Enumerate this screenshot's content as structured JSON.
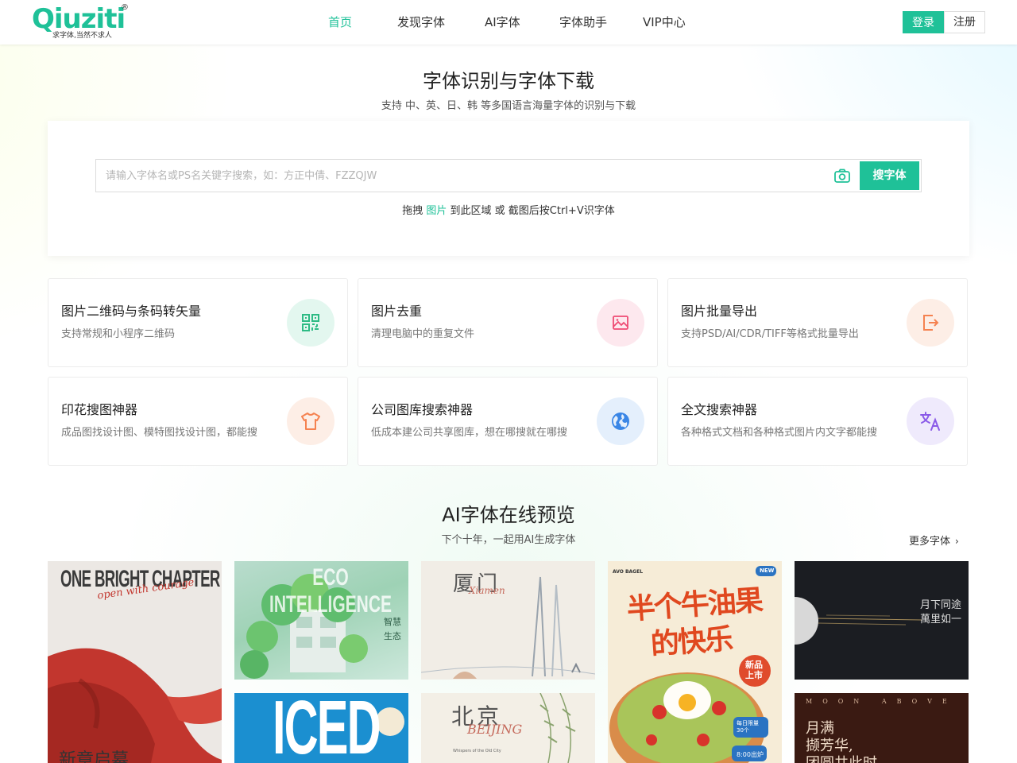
{
  "header": {
    "logo_word": "Qiuziti",
    "logo_reg": "®",
    "logo_slogan": "求字体,当然不求人",
    "nav": [
      {
        "label": "首页",
        "active": true
      },
      {
        "label": "发现字体",
        "active": false
      },
      {
        "label": "AI字体",
        "active": false
      },
      {
        "label": "字体助手",
        "active": false
      },
      {
        "label": "VIP中心",
        "active": false
      }
    ],
    "login": "登录",
    "register": "注册"
  },
  "hero": {
    "title": "字体识别与字体下载",
    "subtitle": "支持 中、英、日、韩 等多国语言海量字体的识别与下载",
    "search_placeholder": "请输入字体名或PS名关键字搜索，如：方正中倩、FZZQJW",
    "search_value": "",
    "search_button": "搜字体",
    "camera_icon": "camera-icon",
    "drop_hint_prefix": "拖拽 ",
    "drop_hint_highlight": "图片",
    "drop_hint_suffix": " 到此区域 或 截图后按Ctrl+V识字体"
  },
  "tools": [
    {
      "title": "图片二维码与条码转矢量",
      "desc": "支持常规和小程序二维码",
      "icon": "qrcode-icon",
      "bg": "#e3f7ef",
      "color": "#2dbb84"
    },
    {
      "title": "图片去重",
      "desc": "清理电脑中的重复文件",
      "icon": "image-icon",
      "bg": "#fde8ee",
      "color": "#ef4b74"
    },
    {
      "title": "图片批量导出",
      "desc": "支持PSD/AI/CDR/TIFF等格式批量导出",
      "icon": "export-icon",
      "bg": "#fdeee6",
      "color": "#f58250"
    },
    {
      "title": "印花搜图神器",
      "desc": "成品图找设计图、模特图找设计图，都能搜",
      "icon": "tshirt-icon",
      "bg": "#fdeee6",
      "color": "#f58250"
    },
    {
      "title": "公司图库搜索神器",
      "desc": "低成本建公司共享图库，想在哪搜就在哪搜",
      "icon": "globe-icon",
      "bg": "#e4effc",
      "color": "#3a86e6"
    },
    {
      "title": "全文搜索神器",
      "desc": "各种格式文档和各种格式图片内文字都能搜",
      "icon": "translate-icon",
      "bg": "#efeafc",
      "color": "#8a5ae8"
    }
  ],
  "ai": {
    "title": "AI字体在线预览",
    "subtitle": "下个十年，一起用AI生成字体",
    "more": "更多字体",
    "more_icon": "chevron-right-icon",
    "tiles": [
      {
        "name": "one-bright-chapter",
        "text_main": "ONE BRIGHT CHAPTER",
        "text_script": "open with courage",
        "text_cn": "新章启幕"
      },
      {
        "name": "eco-intelligence",
        "text_main": "ECO INTELLIGENCE",
        "text_cn1": "智慧",
        "text_cn2": "生态"
      },
      {
        "name": "xiamen",
        "text_main": "厦门",
        "text_script": "Xiamen"
      },
      {
        "name": "butter-fruit",
        "text_brand": "AVO BAGEL",
        "text_new": "NEW",
        "text_main1": "半个牛油果",
        "text_main2": "的快乐",
        "text_badge": "新品上市",
        "text_limit": "每日限量 30个",
        "text_time": "8:00出炉"
      },
      {
        "name": "moon-road",
        "text_main1": "月下同途",
        "text_main2": "萬里如一"
      },
      {
        "name": "iced",
        "text_main": "ICED"
      },
      {
        "name": "beijing",
        "text_main": "北京",
        "text_script": "BEIJING",
        "text_small": "Whispers of the Old City"
      },
      {
        "name": "moon-above-us",
        "text_top": "MOON ABOVE US",
        "text_main1": "月满",
        "text_main2": "撷芳华,",
        "text_main3": "团圆共此时"
      }
    ]
  }
}
